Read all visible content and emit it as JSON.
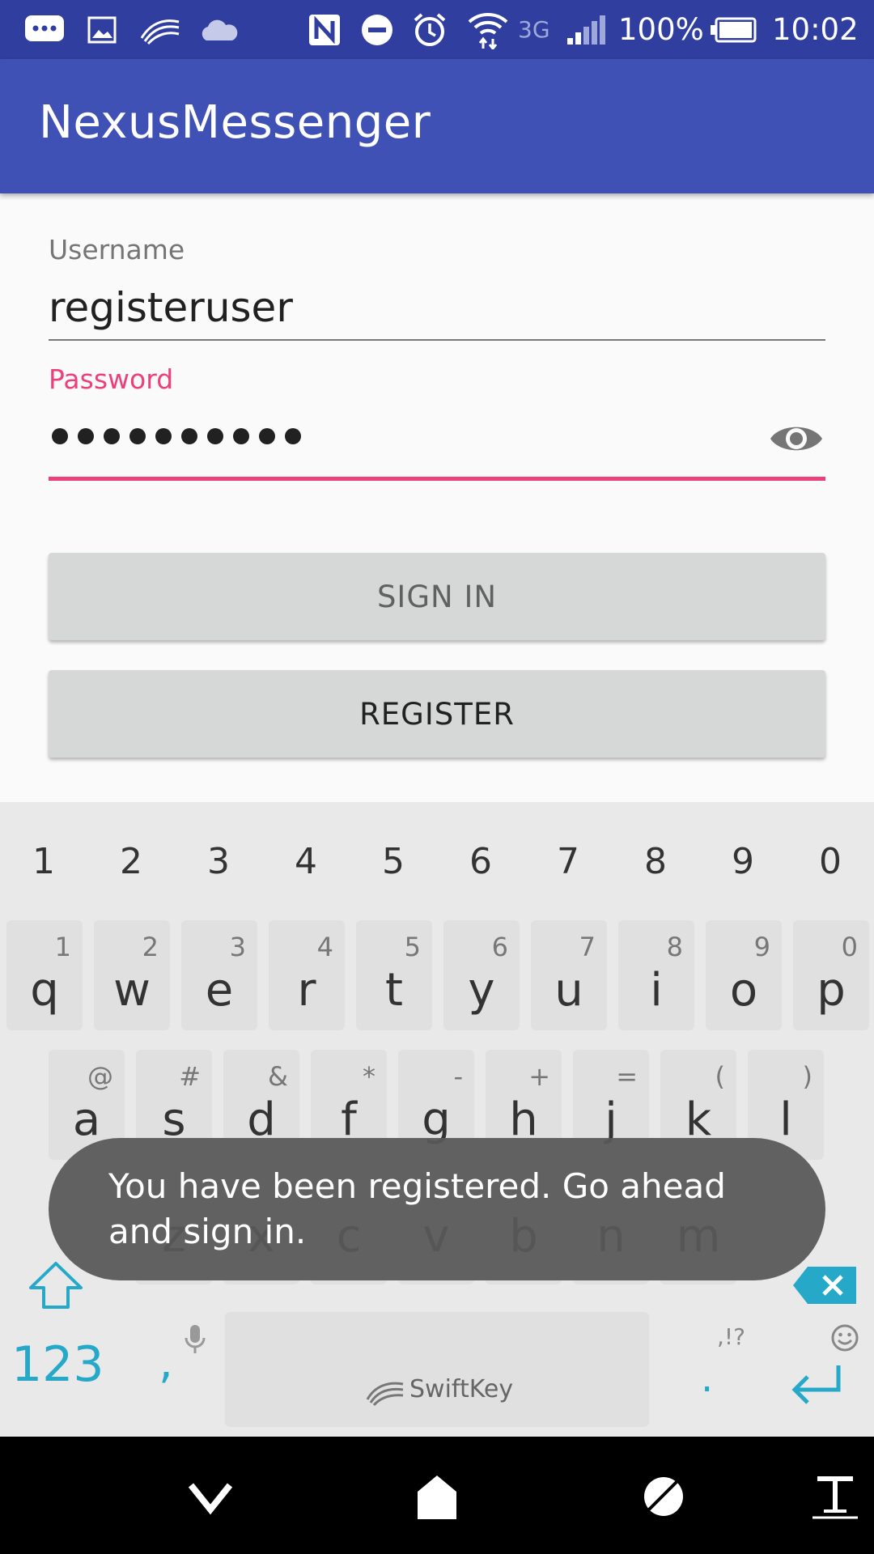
{
  "status_bar": {
    "icons": [
      "chat-bubble-icon",
      "image-icon",
      "swiftkey-icon",
      "cloud-icon",
      "nfc-icon",
      "do-not-disturb-icon",
      "alarm-icon",
      "wifi-icon"
    ],
    "network": "3G",
    "battery_percent": "100%",
    "time": "10:02"
  },
  "app_bar": {
    "title": "NexusMessenger",
    "color": "#3F51B5"
  },
  "form": {
    "username_label": "Username",
    "username_value": "registeruser",
    "password_label": "Password",
    "password_length": 10,
    "password_toggle_icon": "eye-icon",
    "accent_color": "#EC407A"
  },
  "buttons": {
    "sign_in": "SIGN IN",
    "register": "REGISTER"
  },
  "keyboard": {
    "number_row": [
      "1",
      "2",
      "3",
      "4",
      "5",
      "6",
      "7",
      "8",
      "9",
      "0"
    ],
    "row1": [
      {
        "key": "q",
        "hint": "1"
      },
      {
        "key": "w",
        "hint": "2"
      },
      {
        "key": "e",
        "hint": "3"
      },
      {
        "key": "r",
        "hint": "4"
      },
      {
        "key": "t",
        "hint": "5"
      },
      {
        "key": "y",
        "hint": "6"
      },
      {
        "key": "u",
        "hint": "7"
      },
      {
        "key": "i",
        "hint": "8"
      },
      {
        "key": "o",
        "hint": "9"
      },
      {
        "key": "p",
        "hint": "0"
      }
    ],
    "row2": [
      {
        "key": "a",
        "hint": "@"
      },
      {
        "key": "s",
        "hint": "#"
      },
      {
        "key": "d",
        "hint": "&"
      },
      {
        "key": "f",
        "hint": "*"
      },
      {
        "key": "g",
        "hint": "-"
      },
      {
        "key": "h",
        "hint": "+"
      },
      {
        "key": "j",
        "hint": "="
      },
      {
        "key": "k",
        "hint": "("
      },
      {
        "key": "l",
        "hint": ")"
      }
    ],
    "row3": [
      "z",
      "x",
      "c",
      "v",
      "b",
      "n",
      "m"
    ],
    "symbols_key": "123",
    "comma_key": ",",
    "space_brand": "SwiftKey",
    "punct_hint": ",!?",
    "period_key": ".",
    "accent_color": "#26A9C9"
  },
  "toast": {
    "message": "You have been registered. Go ahead and sign in."
  }
}
